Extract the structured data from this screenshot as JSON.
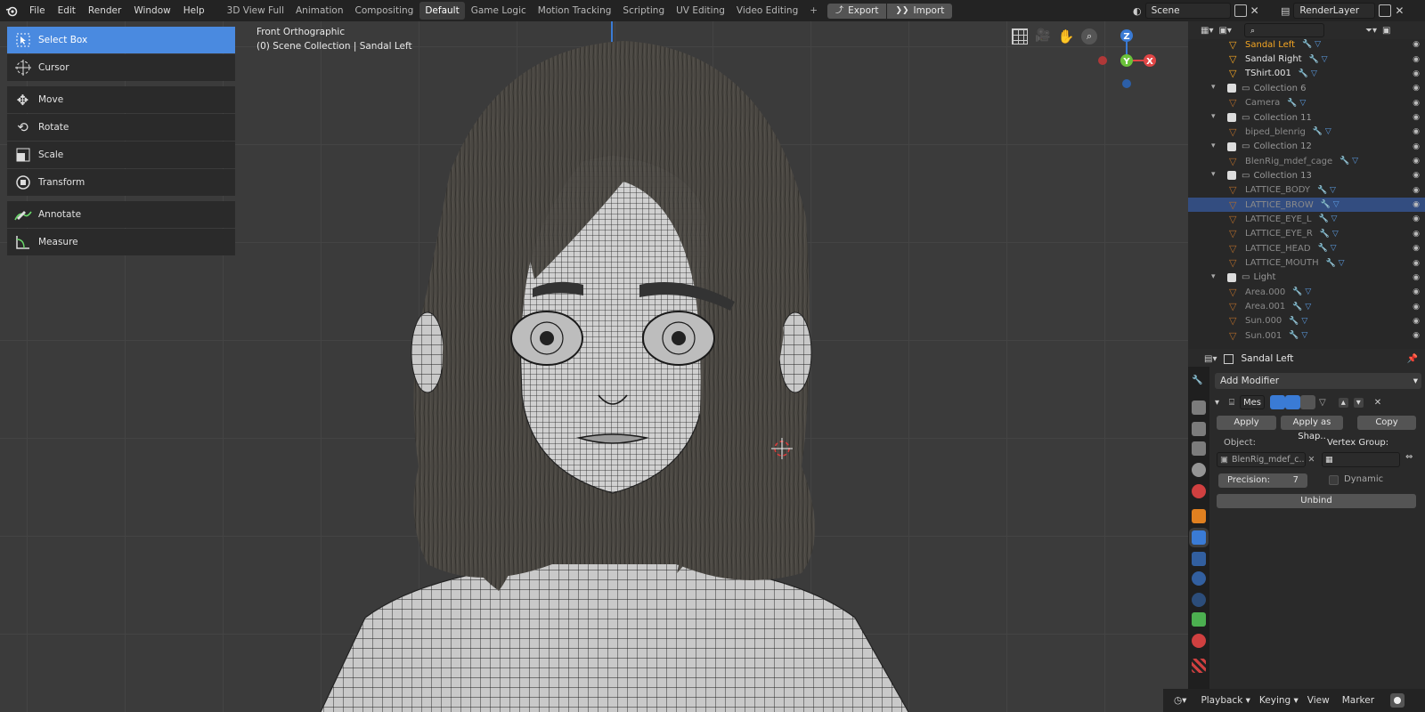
{
  "menubar": {
    "items": [
      "File",
      "Edit",
      "Render",
      "Window",
      "Help"
    ],
    "workspaces": [
      "3D View Full",
      "Animation",
      "Compositing",
      "Default",
      "Game Logic",
      "Motion Tracking",
      "Scripting",
      "UV Editing",
      "Video Editing"
    ],
    "active_workspace": "Default",
    "add_tab": "+",
    "export_label": "Export",
    "import_label": "Import",
    "scene": "Scene",
    "view_layer": "RenderLayer"
  },
  "toolbar": {
    "tools": [
      {
        "label": "Select Box",
        "icon": "select-box-icon",
        "active": true
      },
      {
        "label": "Cursor",
        "icon": "cursor-icon"
      },
      {
        "label": "Move",
        "icon": "move-icon"
      },
      {
        "label": "Rotate",
        "icon": "rotate-icon"
      },
      {
        "label": "Scale",
        "icon": "scale-icon"
      },
      {
        "label": "Transform",
        "icon": "transform-icon"
      },
      {
        "label": "Annotate",
        "icon": "annotate-icon"
      },
      {
        "label": "Measure",
        "icon": "measure-icon"
      }
    ]
  },
  "viewport": {
    "view_name": "Front Orthographic",
    "collection_info": "(0) Scene Collection | Sandal Left",
    "gizmo": {
      "z": "Z",
      "y": "Y",
      "x": "X"
    }
  },
  "outliner": {
    "rows": [
      {
        "label": "Sandal Left",
        "kind": "object",
        "active": true
      },
      {
        "label": "Sandal Right",
        "kind": "object"
      },
      {
        "label": "TShirt.001",
        "kind": "object"
      },
      {
        "label": "Collection 6",
        "kind": "collection"
      },
      {
        "label": "Camera",
        "kind": "object-dim"
      },
      {
        "label": "Collection 11",
        "kind": "collection"
      },
      {
        "label": "biped_blenrig",
        "kind": "object-dim"
      },
      {
        "label": "Collection 12",
        "kind": "collection"
      },
      {
        "label": "BlenRig_mdef_cage",
        "kind": "object-dim"
      },
      {
        "label": "Collection 13",
        "kind": "collection"
      },
      {
        "label": "LATTICE_BODY",
        "kind": "object-dim"
      },
      {
        "label": "LATTICE_BROW",
        "kind": "object-dim",
        "selected": true
      },
      {
        "label": "LATTICE_EYE_L",
        "kind": "object-dim"
      },
      {
        "label": "LATTICE_EYE_R",
        "kind": "object-dim"
      },
      {
        "label": "LATTICE_HEAD",
        "kind": "object-dim"
      },
      {
        "label": "LATTICE_MOUTH",
        "kind": "object-dim"
      },
      {
        "label": "Light",
        "kind": "collection"
      },
      {
        "label": "Area.000",
        "kind": "object-dim"
      },
      {
        "label": "Area.001",
        "kind": "object-dim"
      },
      {
        "label": "Sun.000",
        "kind": "object-dim"
      },
      {
        "label": "Sun.001",
        "kind": "object-dim"
      }
    ]
  },
  "properties": {
    "object_name": "Sandal Left",
    "add_modifier": "Add Modifier",
    "modifier_name": "Mes",
    "apply": "Apply",
    "apply_as_shape": "Apply as Shap..",
    "copy": "Copy",
    "object_label": "Object:",
    "object_value": "BlenRig_mdef_c..",
    "vertex_group_label": "Vertex Group:",
    "precision_label": "Precision:",
    "precision_value": "7",
    "dynamic_label": "Dynamic",
    "unbind": "Unbind"
  },
  "statusbar": {
    "items": [
      "Playback",
      "Keying",
      "View",
      "Marker"
    ]
  },
  "colors": {
    "accent": "#4a8ae0",
    "active_object": "#f5a623",
    "selected_row": "#334d80"
  }
}
